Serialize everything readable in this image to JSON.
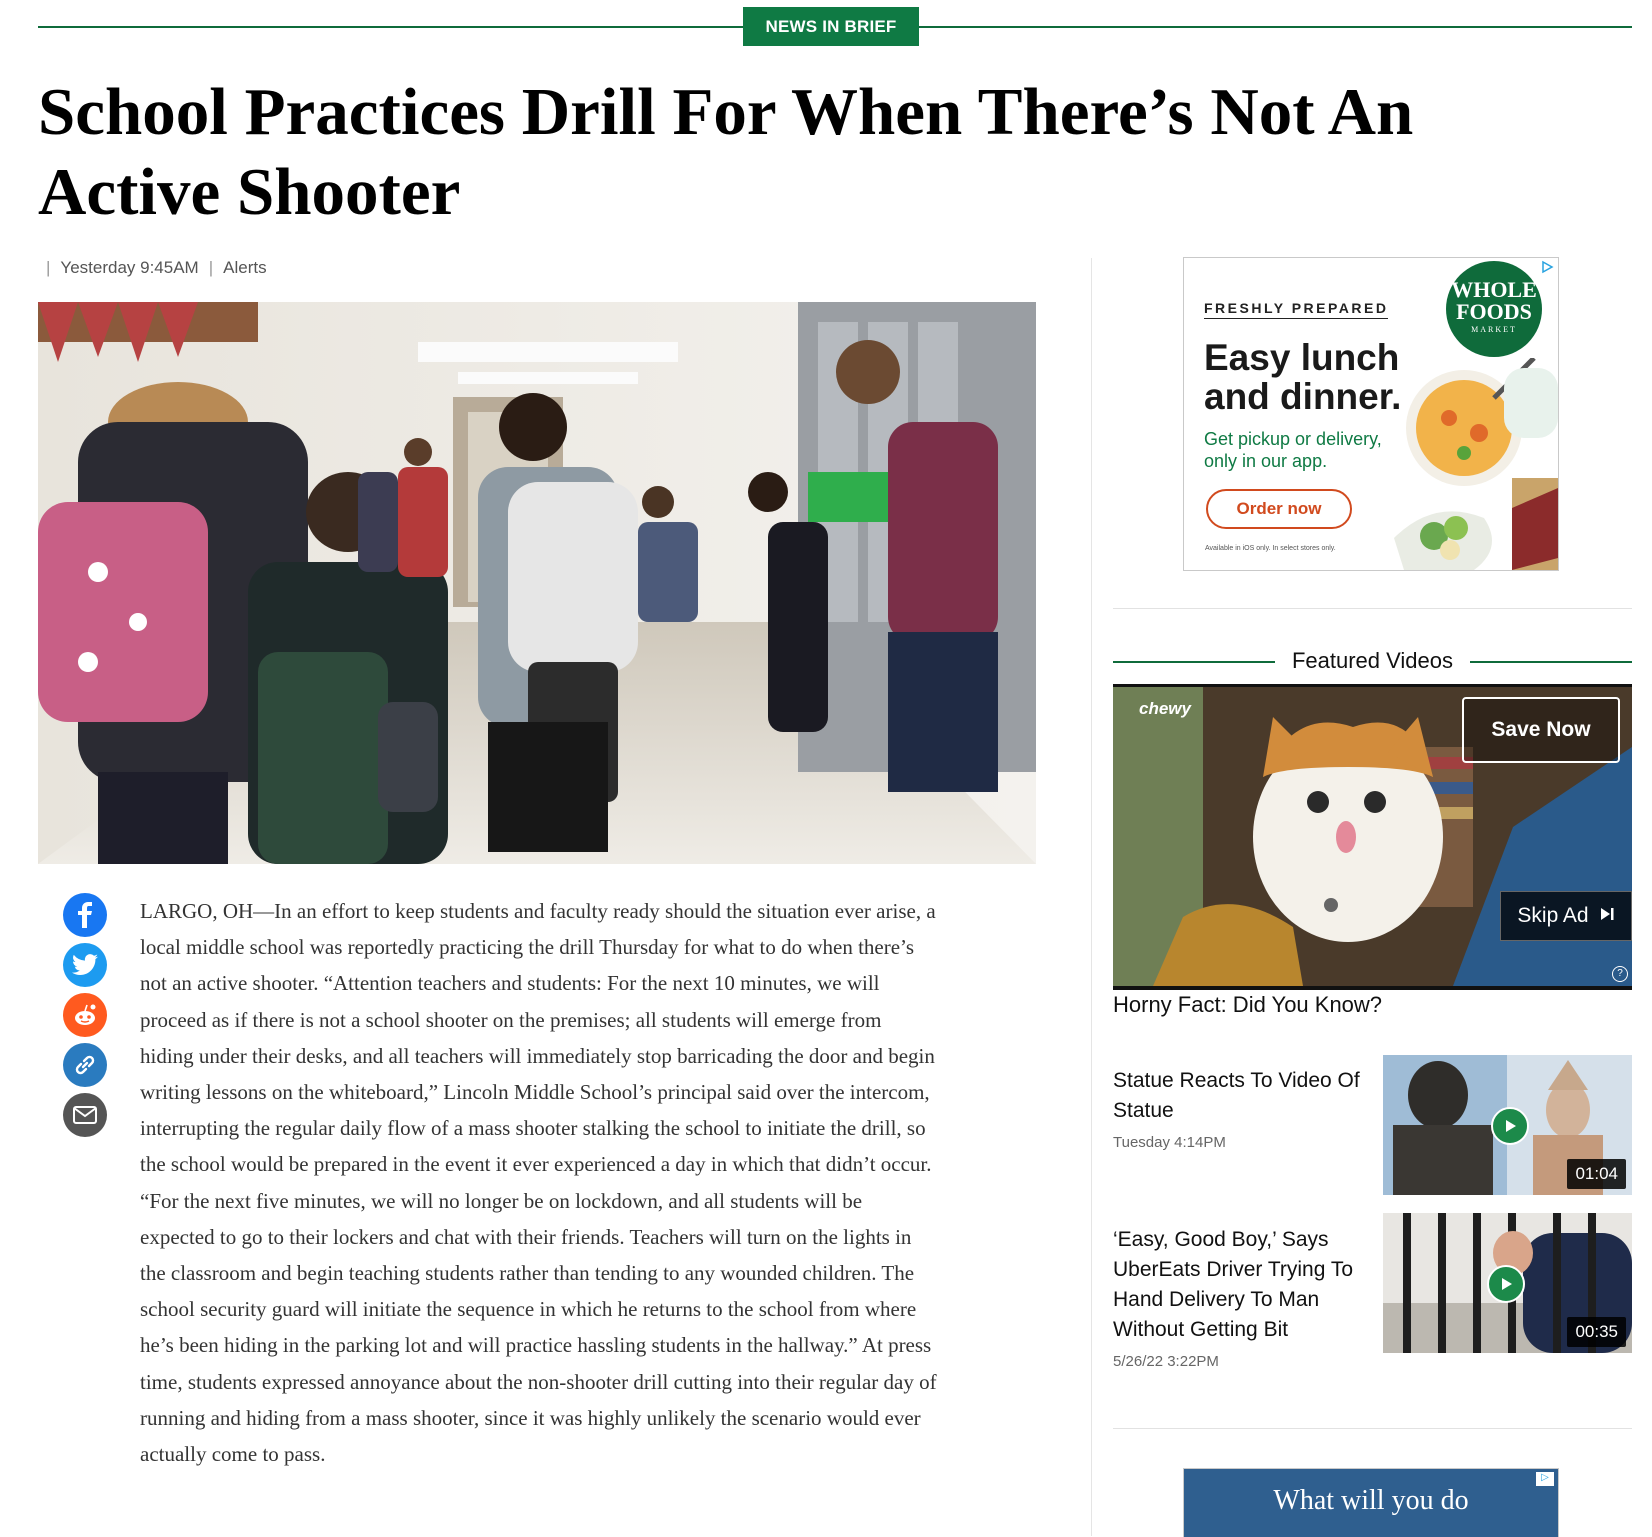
{
  "section": {
    "tag": "NEWS IN BRIEF"
  },
  "article": {
    "headline": "School Practices Drill For When There’s Not An Active Shooter",
    "meta": {
      "timestamp": "Yesterday 9:45AM",
      "category": "Alerts"
    },
    "body": "LARGO, OH—In an effort to keep students and faculty ready should the situation ever arise, a local middle school was reportedly practicing the drill Thursday for what to do when there’s not an active shooter. “Attention teachers and students: For the next 10 minutes, we will proceed as if there is not a school shooter on the premises; all students will emerge from hiding under their desks, and all teachers will immediately stop barricading the door and begin writing lessons on the whiteboard,” Lincoln Middle School’s principal said over the intercom, interrupting the regular daily flow of a mass shooter stalking the school to initiate the drill, so the school would be prepared in the event it ever experienced a day in which that didn’t occur. “For the next five minutes, we will no longer be on lockdown, and all students will be expected to go to their lockers and chat with their friends. Teachers will turn on the lights in the classroom and begin teaching students rather than tending to any wounded children. The school security guard will initiate the sequence in which he returns to the school from where he’s been hiding in the parking lot and will practice hassling students in the hallway.” At press time, students expressed annoyance about the non-shooter drill cutting into their regular day of running and hiding from a mass shooter, since it was highly unlikely the scenario would ever actually come to pass."
  },
  "share": {
    "icons": [
      "facebook-icon",
      "twitter-icon",
      "reddit-icon",
      "link-icon",
      "email-icon"
    ],
    "colors": {
      "facebook": "#1877f2",
      "twitter": "#1d9bf0",
      "reddit": "#ff5a1f",
      "link": "#2a7bbf",
      "email": "#555555"
    }
  },
  "sidebar": {
    "ad_top": {
      "eyebrow": "FRESHLY PREPARED",
      "headline_line1": "Easy lunch",
      "headline_line2": "and dinner.",
      "sub": "Get pickup or delivery, only in our app.",
      "cta": "Order now",
      "fine_print": "Available in iOS only. In select stores only.",
      "logo_line1": "WHOLE",
      "logo_line2": "FOODS",
      "logo_line3": "MARKET"
    },
    "featured_videos": {
      "title": "Featured Videos",
      "player": {
        "brand": "chewy",
        "save_label": "Save Now",
        "skip_label": "Skip Ad",
        "help": "?",
        "caption": "Horny Fact: Did You Know?"
      },
      "items": [
        {
          "title": "Statue Reacts To Video Of Statue",
          "date": "Tuesday 4:14PM",
          "duration": "01:04"
        },
        {
          "title": "‘Easy, Good Boy,’ Says UberEats Driver Trying To Hand Delivery To Man Without Getting Bit",
          "date": "5/26/22 3:22PM",
          "duration": "00:35"
        }
      ]
    },
    "ad_bottom": {
      "text": "What will you do"
    }
  },
  "colors": {
    "brand_green": "#0f7a44",
    "ad_orange": "#d14a1e"
  }
}
